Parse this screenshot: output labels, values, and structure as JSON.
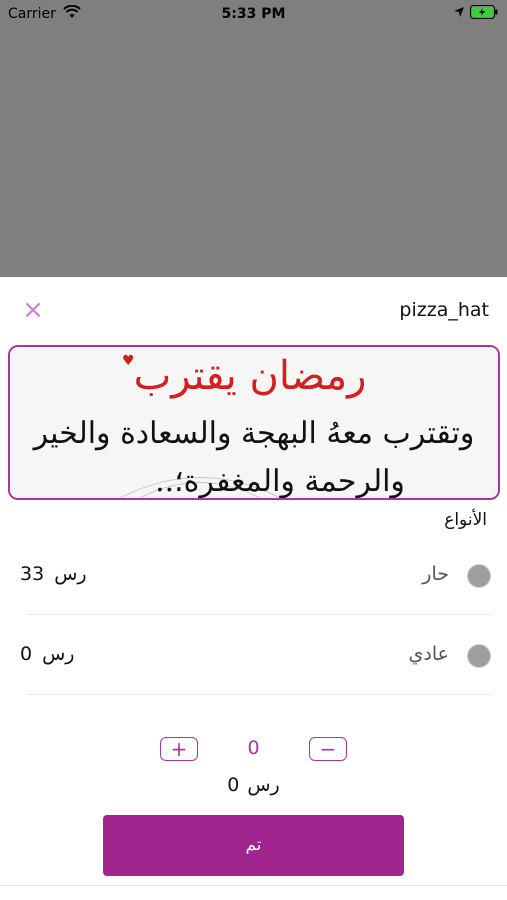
{
  "status_bar": {
    "carrier": "Carrier",
    "time": "5:33 PM"
  },
  "sheet": {
    "title": "pizza_hat",
    "close_icon": "close-icon"
  },
  "banner": {
    "line1": "رمضان يقترب",
    "line2": "وتقترب معهُ البهجة والسعادة والخير",
    "line3": "والرحمة والمغفرة؛.."
  },
  "types": {
    "label": "الأنواع",
    "options": [
      {
        "name": "حار",
        "price": "33",
        "currency": "رس"
      },
      {
        "name": "عادي",
        "price": "0",
        "currency": "رس"
      }
    ]
  },
  "quantity": {
    "plus": "+",
    "minus": "−",
    "value": "0"
  },
  "total": {
    "value": "0",
    "currency": "رس"
  },
  "done_button": {
    "label": "تم"
  },
  "colors": {
    "accent": "#a1258f",
    "close": "#d07fd7",
    "overlay": "#7f7f7f"
  }
}
